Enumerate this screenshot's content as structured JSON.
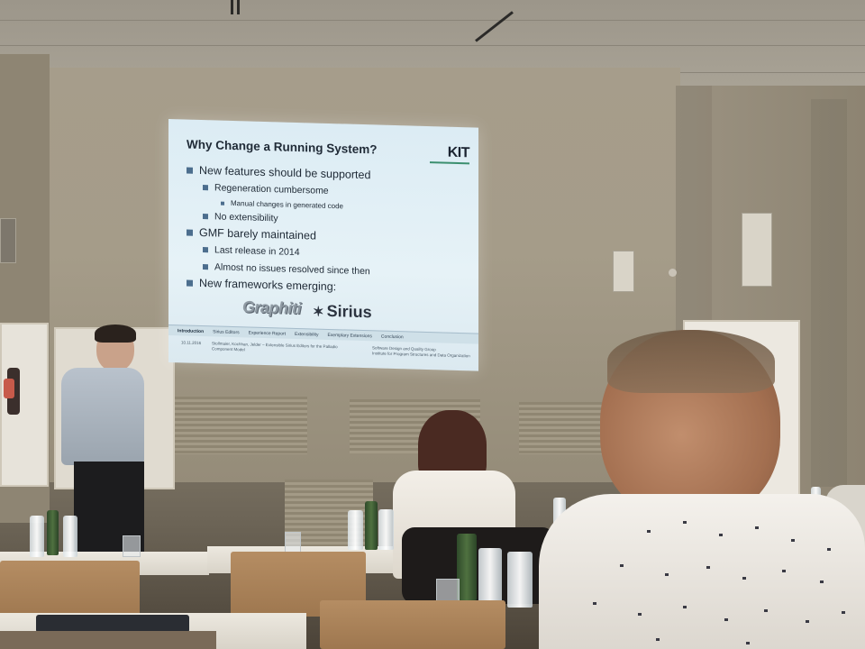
{
  "slide": {
    "title": "Why Change a Running System?",
    "logo_text": "KIT",
    "bullets": [
      {
        "level": 1,
        "text": "New features should be supported"
      },
      {
        "level": 2,
        "text": "Regeneration cumbersome"
      },
      {
        "level": 3,
        "text": "Manual changes in generated code"
      },
      {
        "level": 2,
        "text": "No extensibility"
      },
      {
        "level": 1,
        "text": "GMF barely maintained"
      },
      {
        "level": 2,
        "text": "Last release in 2014"
      },
      {
        "level": 2,
        "text": "Almost no issues resolved since then"
      },
      {
        "level": 1,
        "text": "New frameworks emerging:"
      }
    ],
    "frameworks": {
      "graphiti": "Graphiti",
      "sirius": "Sirius"
    },
    "nav": [
      "Introduction",
      "Sirius Editors",
      "Experience Report",
      "Extensibility",
      "Exemplary Extensions",
      "Conclusion"
    ],
    "nav_active": "Introduction",
    "footer": {
      "date": "10.11.2016",
      "authors": "Stollmaier, Kochhan, Jelder – Extensible Sirius Editors for the Palladio",
      "authors_line2": "Component Model",
      "group": "Software Design and Quality Group",
      "institute": "Institute for Program Structures and Data Organization"
    }
  },
  "colors": {
    "slide_bg": "#e2eff5",
    "bullet": "#4c6e8e",
    "kit_green": "#3b8f6f"
  }
}
